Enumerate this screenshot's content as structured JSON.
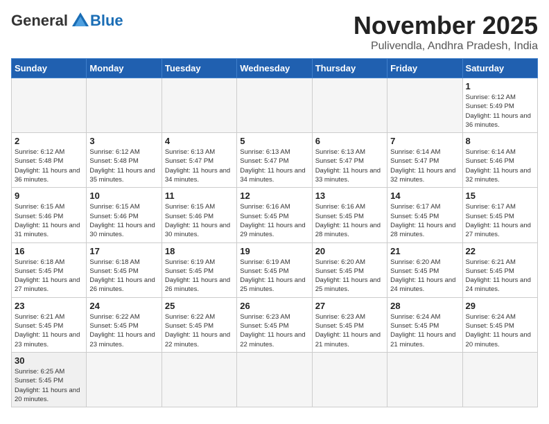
{
  "header": {
    "logo_general": "General",
    "logo_blue": "Blue",
    "month_title": "November 2025",
    "location": "Pulivendla, Andhra Pradesh, India"
  },
  "days_of_week": [
    "Sunday",
    "Monday",
    "Tuesday",
    "Wednesday",
    "Thursday",
    "Friday",
    "Saturday"
  ],
  "weeks": [
    [
      {
        "day": "",
        "empty": true
      },
      {
        "day": "",
        "empty": true
      },
      {
        "day": "",
        "empty": true
      },
      {
        "day": "",
        "empty": true
      },
      {
        "day": "",
        "empty": true
      },
      {
        "day": "",
        "empty": true
      },
      {
        "day": "1",
        "sunrise": "6:12 AM",
        "sunset": "5:49 PM",
        "daylight": "11 hours and 36 minutes."
      }
    ],
    [
      {
        "day": "2",
        "sunrise": "6:12 AM",
        "sunset": "5:48 PM",
        "daylight": "11 hours and 36 minutes."
      },
      {
        "day": "3",
        "sunrise": "6:12 AM",
        "sunset": "5:48 PM",
        "daylight": "11 hours and 35 minutes."
      },
      {
        "day": "4",
        "sunrise": "6:13 AM",
        "sunset": "5:47 PM",
        "daylight": "11 hours and 34 minutes."
      },
      {
        "day": "5",
        "sunrise": "6:13 AM",
        "sunset": "5:47 PM",
        "daylight": "11 hours and 34 minutes."
      },
      {
        "day": "6",
        "sunrise": "6:13 AM",
        "sunset": "5:47 PM",
        "daylight": "11 hours and 33 minutes."
      },
      {
        "day": "7",
        "sunrise": "6:14 AM",
        "sunset": "5:47 PM",
        "daylight": "11 hours and 32 minutes."
      },
      {
        "day": "8",
        "sunrise": "6:14 AM",
        "sunset": "5:46 PM",
        "daylight": "11 hours and 32 minutes."
      }
    ],
    [
      {
        "day": "9",
        "sunrise": "6:15 AM",
        "sunset": "5:46 PM",
        "daylight": "11 hours and 31 minutes."
      },
      {
        "day": "10",
        "sunrise": "6:15 AM",
        "sunset": "5:46 PM",
        "daylight": "11 hours and 30 minutes."
      },
      {
        "day": "11",
        "sunrise": "6:15 AM",
        "sunset": "5:46 PM",
        "daylight": "11 hours and 30 minutes."
      },
      {
        "day": "12",
        "sunrise": "6:16 AM",
        "sunset": "5:45 PM",
        "daylight": "11 hours and 29 minutes."
      },
      {
        "day": "13",
        "sunrise": "6:16 AM",
        "sunset": "5:45 PM",
        "daylight": "11 hours and 28 minutes."
      },
      {
        "day": "14",
        "sunrise": "6:17 AM",
        "sunset": "5:45 PM",
        "daylight": "11 hours and 28 minutes."
      },
      {
        "day": "15",
        "sunrise": "6:17 AM",
        "sunset": "5:45 PM",
        "daylight": "11 hours and 27 minutes."
      }
    ],
    [
      {
        "day": "16",
        "sunrise": "6:18 AM",
        "sunset": "5:45 PM",
        "daylight": "11 hours and 27 minutes."
      },
      {
        "day": "17",
        "sunrise": "6:18 AM",
        "sunset": "5:45 PM",
        "daylight": "11 hours and 26 minutes."
      },
      {
        "day": "18",
        "sunrise": "6:19 AM",
        "sunset": "5:45 PM",
        "daylight": "11 hours and 26 minutes."
      },
      {
        "day": "19",
        "sunrise": "6:19 AM",
        "sunset": "5:45 PM",
        "daylight": "11 hours and 25 minutes."
      },
      {
        "day": "20",
        "sunrise": "6:20 AM",
        "sunset": "5:45 PM",
        "daylight": "11 hours and 25 minutes."
      },
      {
        "day": "21",
        "sunrise": "6:20 AM",
        "sunset": "5:45 PM",
        "daylight": "11 hours and 24 minutes."
      },
      {
        "day": "22",
        "sunrise": "6:21 AM",
        "sunset": "5:45 PM",
        "daylight": "11 hours and 24 minutes."
      }
    ],
    [
      {
        "day": "23",
        "sunrise": "6:21 AM",
        "sunset": "5:45 PM",
        "daylight": "11 hours and 23 minutes."
      },
      {
        "day": "24",
        "sunrise": "6:22 AM",
        "sunset": "5:45 PM",
        "daylight": "11 hours and 23 minutes."
      },
      {
        "day": "25",
        "sunrise": "6:22 AM",
        "sunset": "5:45 PM",
        "daylight": "11 hours and 22 minutes."
      },
      {
        "day": "26",
        "sunrise": "6:23 AM",
        "sunset": "5:45 PM",
        "daylight": "11 hours and 22 minutes."
      },
      {
        "day": "27",
        "sunrise": "6:23 AM",
        "sunset": "5:45 PM",
        "daylight": "11 hours and 21 minutes."
      },
      {
        "day": "28",
        "sunrise": "6:24 AM",
        "sunset": "5:45 PM",
        "daylight": "11 hours and 21 minutes."
      },
      {
        "day": "29",
        "sunrise": "6:24 AM",
        "sunset": "5:45 PM",
        "daylight": "11 hours and 20 minutes."
      }
    ],
    [
      {
        "day": "30",
        "sunrise": "6:25 AM",
        "sunset": "5:45 PM",
        "daylight": "11 hours and 20 minutes."
      },
      {
        "day": "",
        "empty": true
      },
      {
        "day": "",
        "empty": true
      },
      {
        "day": "",
        "empty": true
      },
      {
        "day": "",
        "empty": true
      },
      {
        "day": "",
        "empty": true
      },
      {
        "day": "",
        "empty": true
      }
    ]
  ]
}
